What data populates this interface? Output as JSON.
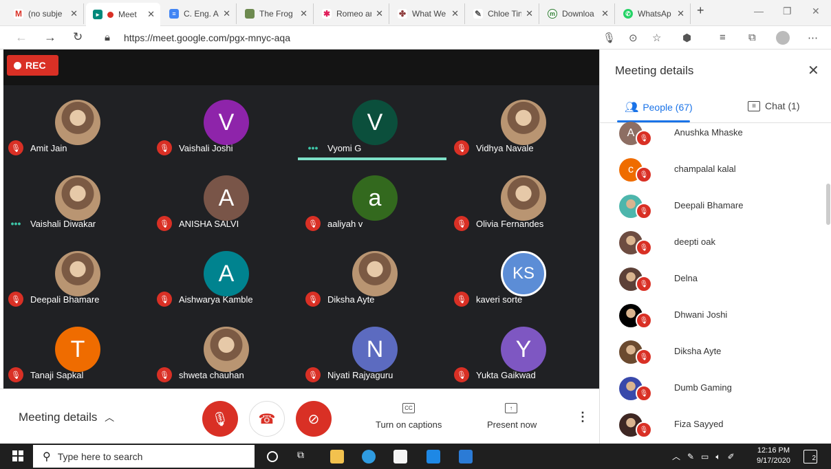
{
  "browser": {
    "tabs": [
      {
        "label": "(no subje",
        "icon": "gmail-icon",
        "color": "#d93025",
        "glyph": "M"
      },
      {
        "label": "Meet",
        "icon": "meet-icon",
        "color": "#00897b",
        "glyph": "●"
      },
      {
        "label": "C. Eng. A",
        "icon": "docs-icon",
        "color": "#4285f4",
        "glyph": "≡"
      },
      {
        "label": "The Frog",
        "icon": "image-icon",
        "color": "#6d8a4f",
        "glyph": ""
      },
      {
        "label": "Romeo ar",
        "icon": "slack-icon",
        "color": "#e01e5a",
        "glyph": "✱"
      },
      {
        "label": "What We",
        "icon": "site-icon",
        "color": "#8d3b3b",
        "glyph": "✤"
      },
      {
        "label": "Chloe Tin",
        "icon": "site-icon",
        "color": "#555555",
        "glyph": "✎"
      },
      {
        "label": "Downloa",
        "icon": "download-site-icon",
        "color": "#2e7d32",
        "glyph": "m"
      },
      {
        "label": "WhatsAp",
        "icon": "whatsapp-icon",
        "color": "#25d366",
        "glyph": "✆"
      }
    ],
    "new_tab": "+",
    "url": "https://meet.google.com/pgx-mnyc-aqa"
  },
  "meet": {
    "rec_label": "REC",
    "tiles": [
      {
        "name": "Amit Jain",
        "initial": "",
        "color": "",
        "state": "muted"
      },
      {
        "name": "Vaishali Joshi",
        "initial": "V",
        "color": "#8e24aa",
        "state": "muted"
      },
      {
        "name": "Vyomi G",
        "initial": "V",
        "color": "#0b4f3c",
        "state": "speaking"
      },
      {
        "name": "Vidhya Navale",
        "initial": "",
        "color": "",
        "state": "muted"
      },
      {
        "name": "Vaishali Diwakar",
        "initial": "",
        "color": "",
        "state": "speaking"
      },
      {
        "name": "ANISHA SALVI",
        "initial": "A",
        "color": "#795548",
        "state": "muted"
      },
      {
        "name": "aaliyah v",
        "initial": "a",
        "color": "#33691e",
        "state": "muted"
      },
      {
        "name": "Olivia Fernandes",
        "initial": "",
        "color": "",
        "state": "muted"
      },
      {
        "name": "Deepali Bhamare",
        "initial": "",
        "color": "",
        "state": "muted"
      },
      {
        "name": "Aishwarya Kamble",
        "initial": "A",
        "color": "#00838f",
        "state": "muted"
      },
      {
        "name": "Diksha Ayte",
        "initial": "",
        "color": "",
        "state": "muted"
      },
      {
        "name": "kaveri sorte",
        "initial": "KS",
        "color": "#5c8dd6",
        "state": "muted"
      },
      {
        "name": "Tanaji Sapkal",
        "initial": "T",
        "color": "#ef6c00",
        "state": "muted"
      },
      {
        "name": "shweta chauhan",
        "initial": "",
        "color": "",
        "state": "muted"
      },
      {
        "name": "Niyati Rajyaguru",
        "initial": "N",
        "color": "#5c6bc0",
        "state": "muted"
      },
      {
        "name": "Yukta Gaikwad",
        "initial": "Y",
        "color": "#7e57c2",
        "state": "muted"
      }
    ],
    "bottom": {
      "meeting_details": "Meeting details",
      "captions": "Turn on captions",
      "present": "Present now"
    }
  },
  "panel": {
    "title": "Meeting details",
    "people_tab": "People (67)",
    "chat_tab": "Chat (1)",
    "people": [
      {
        "name": "Anushka Mhaske",
        "initial": "A",
        "color": "#8d6e63"
      },
      {
        "name": "champalal kalal",
        "initial": "c",
        "color": "#ef6c00"
      },
      {
        "name": "Deepali Bhamare",
        "initial": "",
        "color": "#4db6ac"
      },
      {
        "name": "deepti oak",
        "initial": "",
        "color": "#6d4c41"
      },
      {
        "name": "Delna",
        "initial": "",
        "color": "#5d4037"
      },
      {
        "name": "Dhwani Joshi",
        "initial": "",
        "color": "#000000"
      },
      {
        "name": "Diksha Ayte",
        "initial": "",
        "color": "#6b4a2f"
      },
      {
        "name": "Dumb Gaming",
        "initial": "",
        "color": "#3949ab"
      },
      {
        "name": "Fiza Sayyed",
        "initial": "",
        "color": "#3e2723"
      }
    ]
  },
  "taskbar": {
    "search_placeholder": "Type here to search",
    "time": "12:16 PM",
    "date": "9/17/2020",
    "notifications": "2"
  },
  "colors": {
    "meet_red": "#d93025",
    "meet_blue": "#1a73e8",
    "stage_bg": "#202124",
    "speaking_teal": "#7ee0c8"
  }
}
